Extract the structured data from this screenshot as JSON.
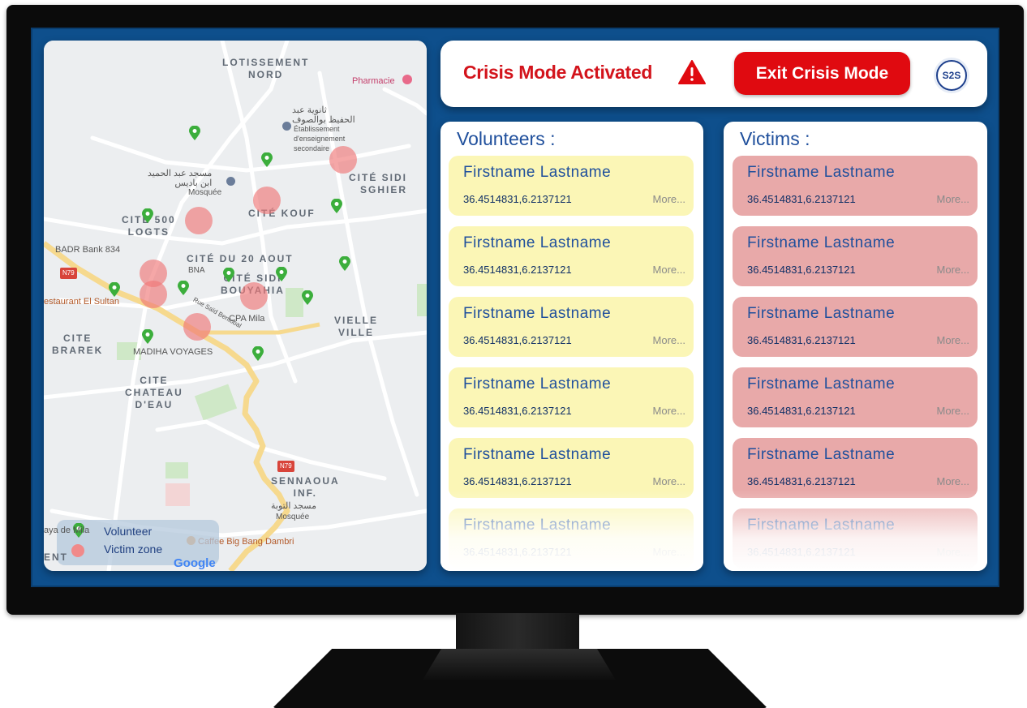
{
  "header": {
    "crisis_title": "Crisis Mode Activated",
    "exit_label": "Exit Crisis Mode",
    "logo_text": "S2S",
    "accent_color": "#e00a10"
  },
  "volunteers": {
    "title": "Volunteers :",
    "card_color": "#fbf6b6",
    "items": [
      {
        "name": "Firstname Lastname",
        "coords": "36.4514831,6.2137121",
        "more": "More..."
      },
      {
        "name": "Firstname Lastname",
        "coords": "36.4514831,6.2137121",
        "more": "More..."
      },
      {
        "name": "Firstname Lastname",
        "coords": "36.4514831,6.2137121",
        "more": "More..."
      },
      {
        "name": "Firstname Lastname",
        "coords": "36.4514831,6.2137121",
        "more": "More..."
      },
      {
        "name": "Firstname Lastname",
        "coords": "36.4514831,6.2137121",
        "more": "More..."
      },
      {
        "name": "Firstname Lastname",
        "coords": "36.4514831,6.2137121",
        "more": "More..."
      }
    ]
  },
  "victims": {
    "title": "Victims :",
    "card_color": "#e8a9a9",
    "items": [
      {
        "name": "Firstname Lastname",
        "coords": "36.4514831,6.2137121",
        "more": "More..."
      },
      {
        "name": "Firstname Lastname",
        "coords": "36.4514831,6.2137121",
        "more": "More..."
      },
      {
        "name": "Firstname Lastname",
        "coords": "36.4514831,6.2137121",
        "more": "More..."
      },
      {
        "name": "Firstname Lastname",
        "coords": "36.4514831,6.2137121",
        "more": "More..."
      },
      {
        "name": "Firstname Lastname",
        "coords": "36.4514831,6.2137121",
        "more": "More..."
      },
      {
        "name": "Firstname Lastname",
        "coords": "36.4514831,6.2137121",
        "more": "More..."
      }
    ]
  },
  "map": {
    "labels": {
      "lotissement": "LOTISSEMENT\nNORD",
      "pharmacie": "Pharmacie",
      "ecole_ar": "ثانوية عبد\nالحفيظ بوالصوف",
      "ecole_fr": "Établissement\nd'enseignement\nsecondaire",
      "cite_sidi": "CITÉ SIDI\nSGHIER",
      "mosquee_ar": "مسجد عبد الحميد\nابن باديس",
      "mosquee": "Mosquée",
      "cite_kouf": "CITÉ KOUF",
      "cite500": "CITÉ 500\nLOGTS",
      "badr": "BADR Bank 834",
      "cite20": "CITÉ DU 20 AOUT",
      "bna": "BNA",
      "n79": "N79",
      "cite_sidi_b": "CITÉ SIDI\nBOUYAHIA",
      "restaurant": "estaurant El Sultan",
      "cpa": "CPA Mila",
      "rue": "Rue Saïd Bentobal",
      "vielle": "VIELLE\nVILLE",
      "cite_brarek": "CITE\nBRAREK",
      "madiha": "MADIHA VOYAGES",
      "chateau": "CITE\nCHATEAU\nD'EAU",
      "sennaoua": "SENNAOUA\nINF.",
      "mosquee2_ar": "مسجد التوبة",
      "mosquee2": "Mosquée",
      "caffee": "Caffee Big Bang Dambri",
      "aya": "aya de Mila",
      "ent": "ENT",
      "google": "Google"
    },
    "legend": {
      "volunteer": "Volunteer",
      "victim": "Victim zone",
      "volunteer_color": "#3cae3c",
      "victim_color": "#f08a8a"
    }
  }
}
